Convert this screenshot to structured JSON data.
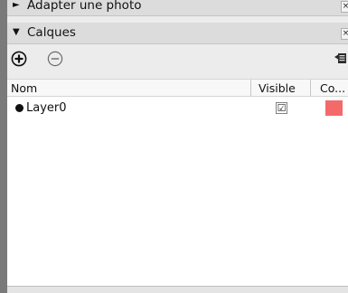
{
  "panels": {
    "adapter": {
      "title": "Adapter une photo",
      "arrow": "►",
      "close": "×"
    },
    "calques": {
      "title": "Calques",
      "arrow": "▼",
      "close": "×"
    }
  },
  "toolbar": {
    "add_icon": "plus-circle-icon",
    "remove_icon": "minus-circle-icon",
    "details_icon": "details-icon"
  },
  "table": {
    "columns": [
      "Nom",
      "Visible",
      "Co..."
    ],
    "rows": [
      {
        "name": "Layer0",
        "visible": "☑",
        "color": "#f46a6a",
        "active": true
      }
    ]
  },
  "colors": {
    "accent_swatch": "#f46a6a",
    "panel_bg": "#ececec"
  }
}
